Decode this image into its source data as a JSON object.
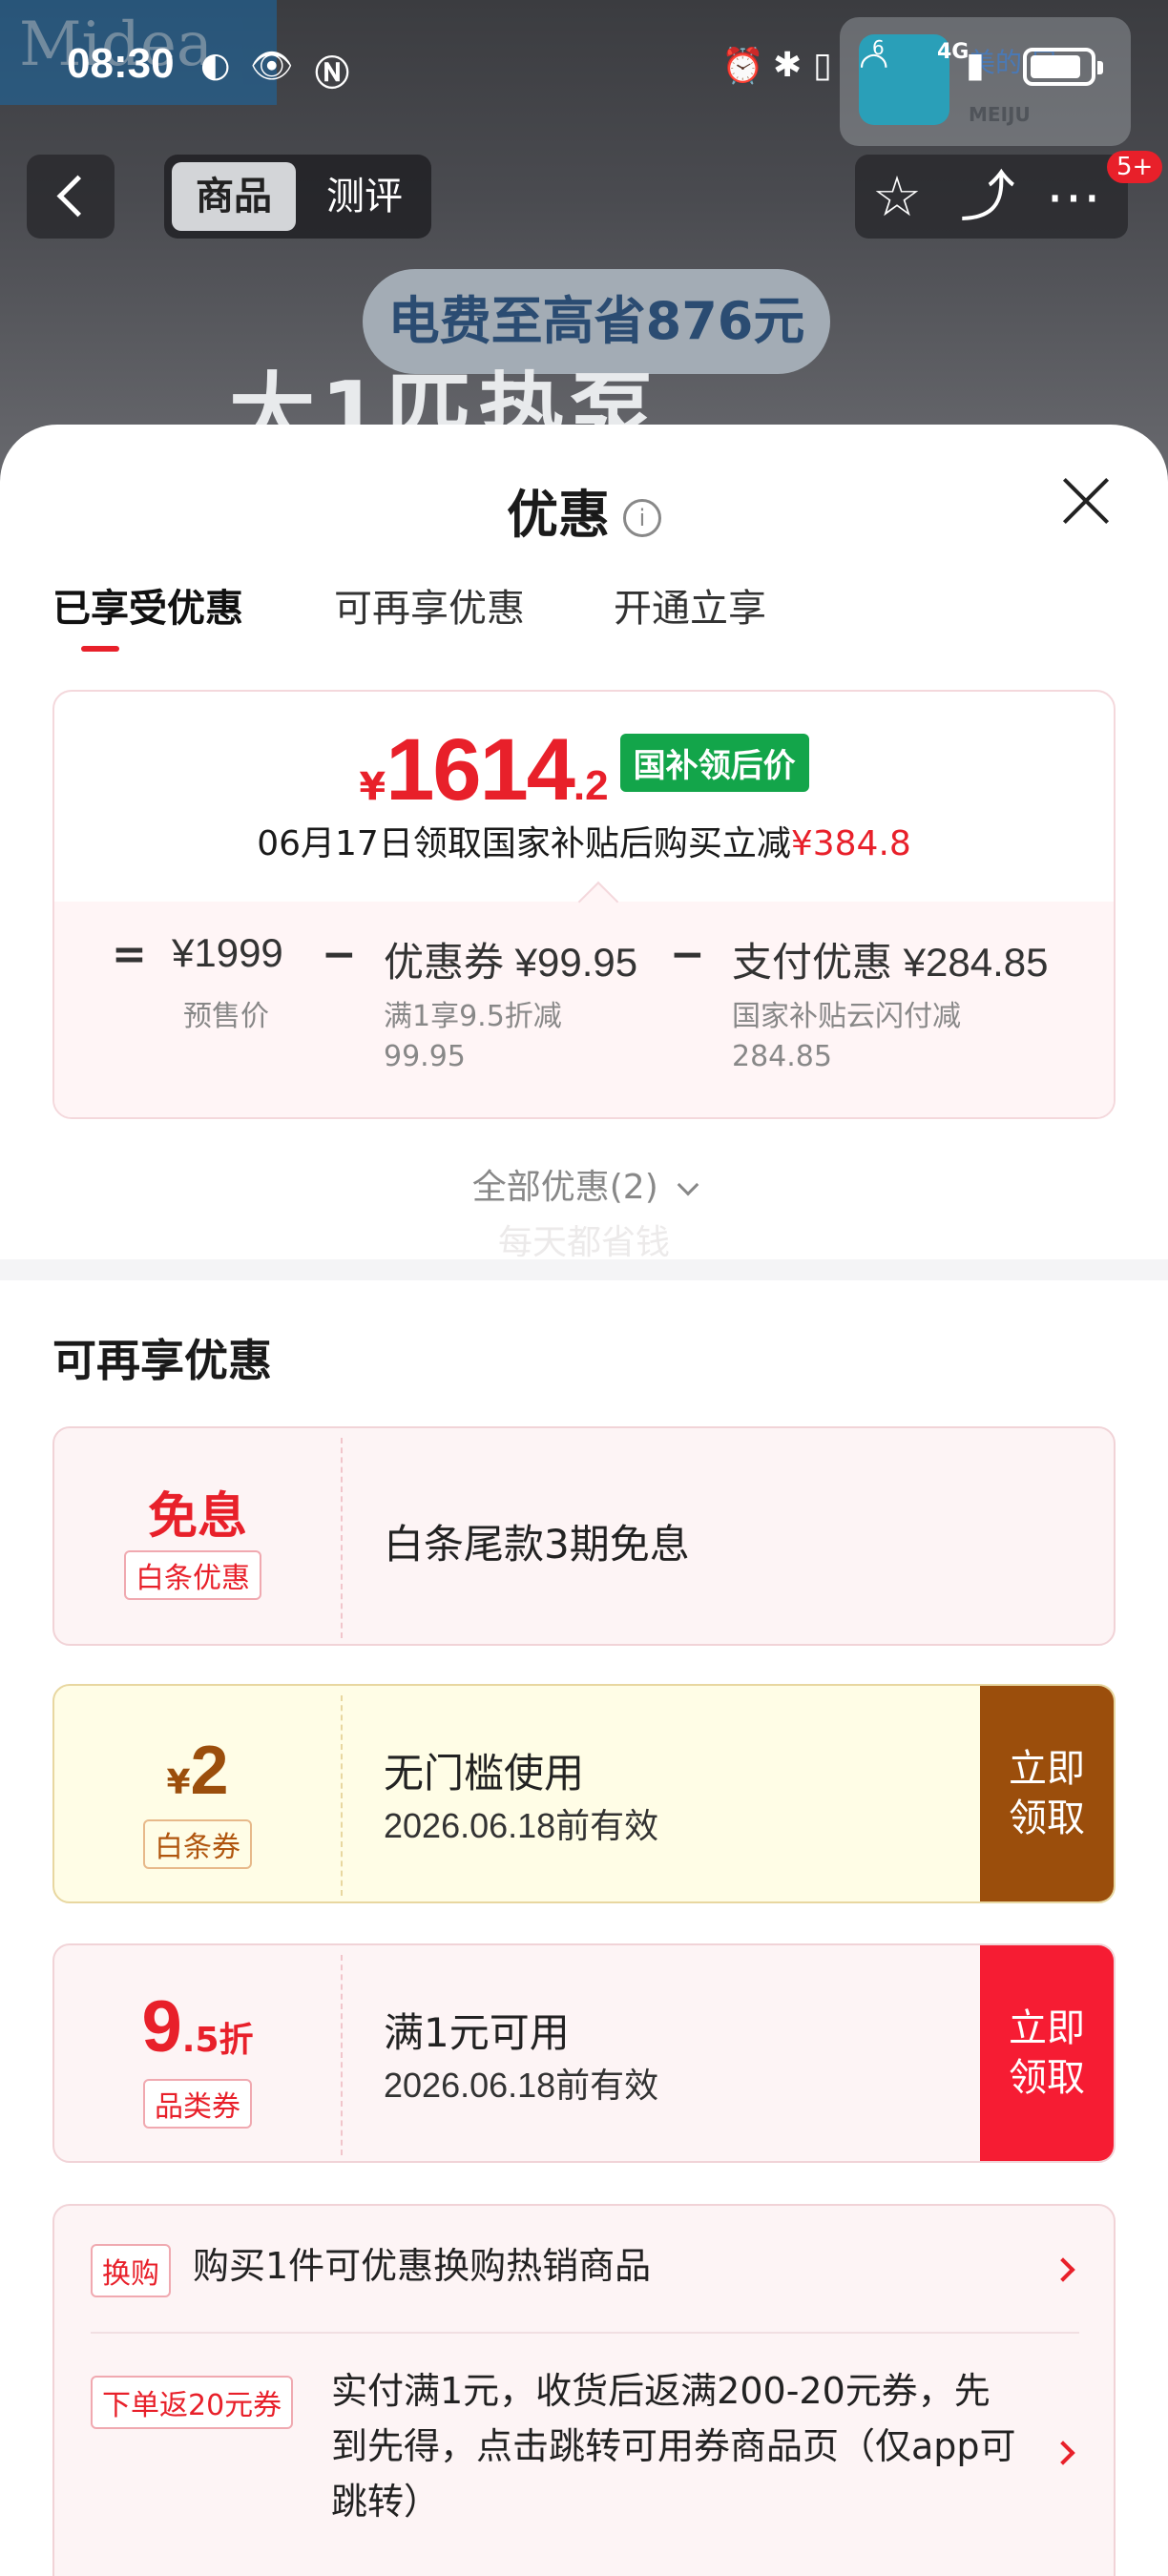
{
  "status_bar": {
    "time": "08:30",
    "network": "4G",
    "network_prefix": "6"
  },
  "hero": {
    "brand_text": "Midea",
    "store_line1": "美的 居",
    "store_line2": "MEIJU",
    "promo_pill": "电费至高省876元",
    "promo_big": "大1匹热泵"
  },
  "nav": {
    "tab_product": "商品",
    "tab_review": "测评",
    "notification_count": "5+"
  },
  "sheet": {
    "title": "优惠",
    "tabs": [
      "已享受优惠",
      "可再享优惠",
      "开通立享"
    ],
    "price_card": {
      "currency": "¥",
      "price_int": "1614",
      "price_dec": ".2",
      "tag": "国补领后价",
      "subtitle_prefix": "06月17日领取国家补贴后购买立减",
      "subtitle_amount": "¥384.8",
      "calc": {
        "eq": "=",
        "base": "¥1999",
        "base_label": "预售价",
        "minus1": "−",
        "coupon": "优惠券 ¥99.95",
        "coupon_label_1": "满1享9.5折减",
        "coupon_label_2": "99.95",
        "minus2": "−",
        "pay": "支付优惠 ¥284.85",
        "pay_label_1": "国家补贴云闪付减",
        "pay_label_2": "284.85"
      }
    },
    "all_discounts": "全部优惠(2)",
    "watermark": "每天都省钱",
    "section_title": "可再享优惠",
    "coupons": [
      {
        "big": "免息",
        "tag": "白条优惠",
        "title": "白条尾款3期免息"
      },
      {
        "currency": "¥",
        "big": "2",
        "tag": "白条券",
        "title": "无门槛使用",
        "date": "2026.06.18前有效",
        "cta_line1": "立即",
        "cta_line2": "领取"
      },
      {
        "big": "9",
        "big_suffix": ".5折",
        "tag": "品类券",
        "title": "满1元可用",
        "date": "2026.06.18前有效",
        "cta_line1": "立即",
        "cta_line2": "领取"
      }
    ],
    "extra": [
      {
        "tag": "换购",
        "text": "购买1件可优惠换购热销商品"
      },
      {
        "tag": "下单返20元券",
        "text_line1": "实付满1元，收货后返满200-20元券，先",
        "text_line2": "到先得，点击跳转可用券商品页（仅app可",
        "text_line3": "跳转）"
      }
    ]
  },
  "colors": {
    "accent_red": "#e8202a",
    "gov_green": "#13a54a",
    "cta_brown": "#9b4e0c",
    "cta_red": "#f61c33"
  }
}
